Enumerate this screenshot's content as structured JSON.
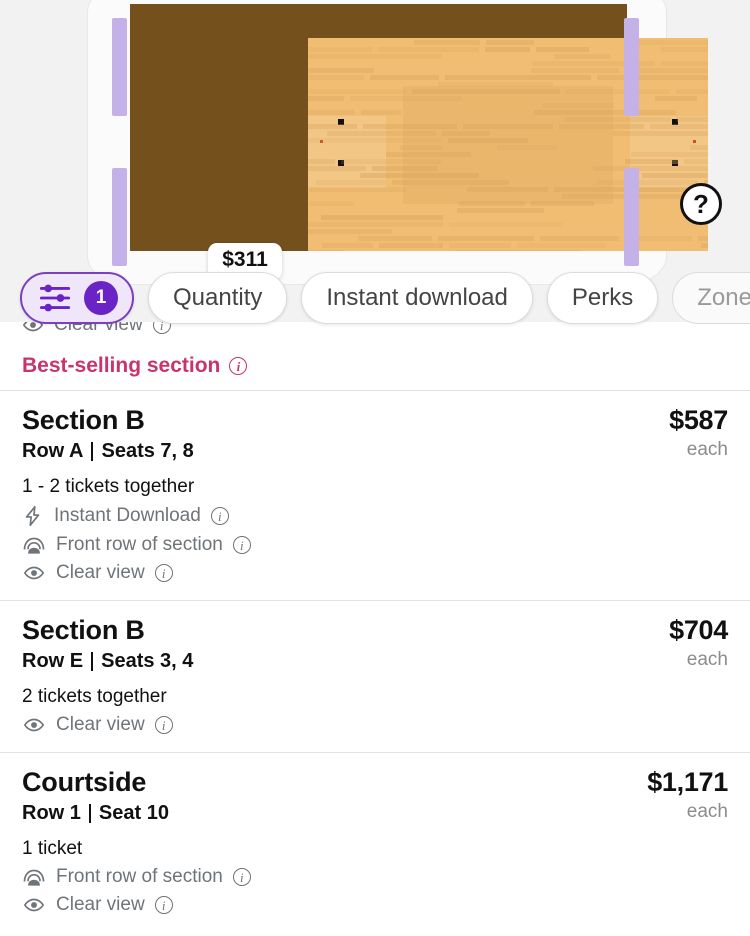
{
  "map": {
    "price_pin": "$311",
    "help_label": "?",
    "court_icon": "basketball-court"
  },
  "chips": [
    {
      "label": "1",
      "name": "filters-chip",
      "type": "filter",
      "active": true
    },
    {
      "label": "Quantity",
      "name": "quantity-chip",
      "type": "plain",
      "active": false
    },
    {
      "label": "Instant download",
      "name": "instant-download-chip",
      "type": "plain",
      "active": false
    },
    {
      "label": "Perks",
      "name": "perks-chip",
      "type": "plain",
      "active": false
    },
    {
      "label": "Zones",
      "name": "zones-chip",
      "type": "disabled",
      "active": false
    }
  ],
  "clipped_perk": "Clear view",
  "best_selling": {
    "label": "Best-selling section",
    "color": "#c8356e"
  },
  "listings": [
    {
      "section": "Section B",
      "row_seat": "Row A | Seats 7, 8",
      "row": "Row A",
      "seats": "Seats 7, 8",
      "price": "$587",
      "price_note": "each",
      "quantity": "1 - 2 tickets together",
      "perks": [
        {
          "icon": "lightning-bolt-icon",
          "label": "Instant Download"
        },
        {
          "icon": "front-row-icon",
          "label": "Front row of section"
        },
        {
          "icon": "eye-icon",
          "label": "Clear view"
        }
      ]
    },
    {
      "section": "Section B",
      "row_seat": "Row E | Seats 3, 4",
      "row": "Row E",
      "seats": "Seats 3, 4",
      "price": "$704",
      "price_note": "each",
      "quantity": "2 tickets together",
      "perks": [
        {
          "icon": "eye-icon",
          "label": "Clear view"
        }
      ]
    },
    {
      "section": "Courtside",
      "row_seat": "Row 1 | Seat 10",
      "row": "Row 1",
      "seats": "Seat 10",
      "price": "$1,171",
      "price_note": "each",
      "quantity": "1 ticket",
      "perks": [
        {
          "icon": "front-row-icon",
          "label": "Front row of section"
        },
        {
          "icon": "eye-icon",
          "label": "Clear view"
        }
      ]
    }
  ],
  "colors": {
    "accent_purple": "#6a23c4",
    "chip_purple_bg": "#efe6fa",
    "section_bar": "#c3b1e8",
    "court_wood": "#f0bd72",
    "court_border": "#74501d",
    "best_selling_pink": "#c8356e",
    "muted_text": "#6f7479"
  }
}
